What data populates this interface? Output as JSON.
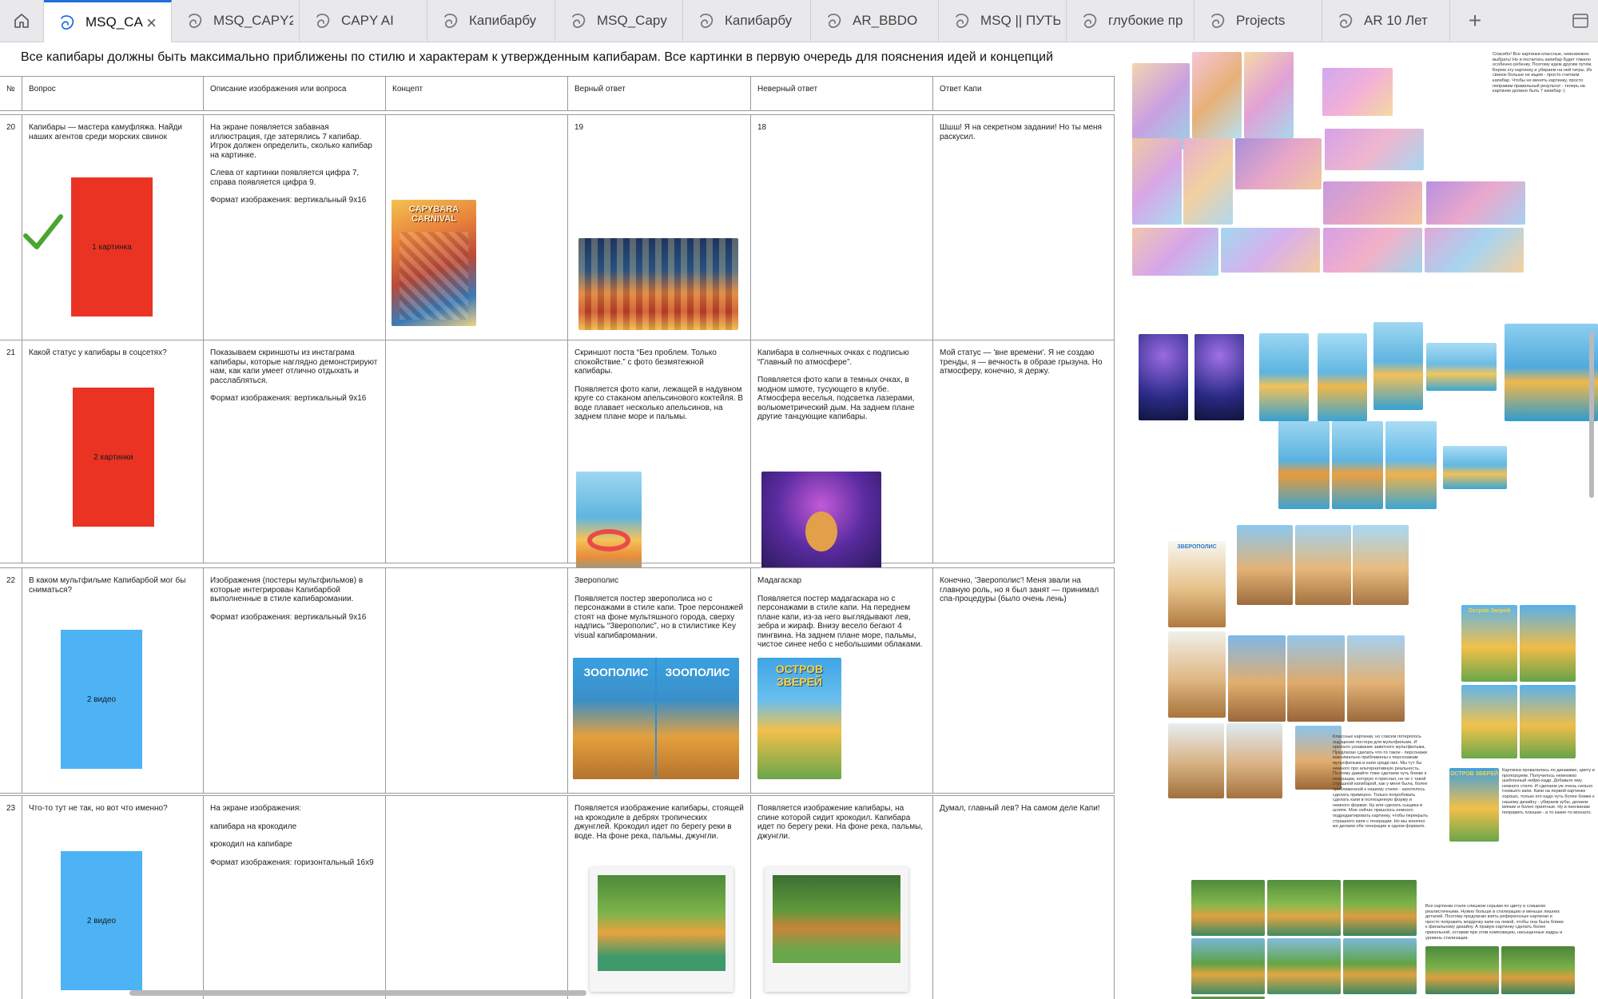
{
  "tabs": [
    {
      "label": "MSQ_CA",
      "active": true
    },
    {
      "label": "MSQ_CAPY2"
    },
    {
      "label": "CAPY AI"
    },
    {
      "label": "Капибарбу"
    },
    {
      "label": "MSQ_Capy"
    },
    {
      "label": "Капибарбу"
    },
    {
      "label": "AR_BBDO"
    },
    {
      "label": "MSQ || ПУТЬ"
    },
    {
      "label": "глубокие пр"
    },
    {
      "label": "Projects"
    },
    {
      "label": "AR 10 Лет"
    }
  ],
  "banner": "Все капибары должны быть максимально приближены по стилю и характерам к утвержденным капибарам. Все картинки в первую очередь для пояснения идей и концепций",
  "headers": {
    "num": "№",
    "question": "Вопрос",
    "description": "Описание изображения или вопроса",
    "concept": "Концепт",
    "correct": "Верный ответ",
    "wrong": "Неверный ответ",
    "kapi": "Ответ Капи"
  },
  "rows": [
    {
      "num": "20",
      "question": "Капибары — мастера камуфляжа. Найди наших агентов среди морских свинок",
      "media_label": "1 картинка",
      "description": [
        "На экране появляется забавная иллюстрация, где затерялись 7 капибар. Игрок должен определить, сколько капибар на картинке.",
        "Слева от картинки появляется цифра 7, справа появляется цифра 9.",
        "Формат изображения: вертикальный 9x16"
      ],
      "concept_image_text": "CAPYBARA CARNIVAL",
      "correct": [
        "19"
      ],
      "wrong": [
        "18"
      ],
      "kapi": "Шшш! Я на секретном задании! Но ты меня раскусил."
    },
    {
      "num": "21",
      "question": "Какой статус у капибары в соцсетях?",
      "media_label": "2 картинки",
      "description": [
        "Показываем скриншоты из инстаграма капибары, которые наглядно демонстрируют нам, как капи умеет отлично отдыхать и расслабляться.",
        "Формат изображения: вертикальный 9x16"
      ],
      "correct": [
        "Скриншот поста “Без проблем. Только спокойствие.” с фото безмятежной капибары.",
        "Появляется фото капи, лежащей в надувном круге со стаканом апельсинового коктейля. В воде плавает несколько апельсинов, на заднем плане море и пальмы."
      ],
      "wrong": [
        "Капибара в солнечных очках с подписью “Главный по атмосфере”.",
        "Появляется фото капи в темных очках, в модном шмоте, тусующего в клубе. Атмосфера веселья, подсветка лазерами, вольюметрический дым. На заднем плане другие танцующие капибары."
      ],
      "kapi": "Мой статус — 'вне времени'. Я не создаю тренды, я — вечность в образе грызуна. Но атмосферу, конечно, я держу."
    },
    {
      "num": "22",
      "question": "В каком мультфильме Капибарбой мог бы сниматься?",
      "media_label": "2 видео",
      "description": [
        "Изображения (постеры мультфильмов) в которые интегрирован Капибарбой выполненные в стиле капибаромании.",
        "Формат изображения: вертикальный 9x16"
      ],
      "correct": [
        "Зверополис",
        "Появляется постер зверополиса но с персонажами в стиле капи. Трое персонажей стоят на фоне мультяшного города, сверху надпись “Зверополис”, но в стилистике Key visual капибаромании."
      ],
      "correct_poster": "ЗООПОЛИС",
      "wrong": [
        "Мадагаскар",
        "Появляется постер мадагаскара но с персонажами в стиле капи. На переднем плане капи, из-за него выглядывают лев, зебра и жираф. Внизу весело бегают 4 пингвина. На заднем плане море, пальмы, чистое синее небо с небольшими облаками."
      ],
      "wrong_poster": "ОСТРОВ ЗВЕРЕЙ",
      "kapi": "Конечно, 'Зверополис'! Меня звали на главную роль, но я был занят — принимал спа-процедуры (было очень лень)"
    },
    {
      "num": "23",
      "question": "Что-то тут не так, но вот что именно?",
      "media_label": "2 видео",
      "description": [
        "На экране изображения:",
        "капибара на крокодиле",
        "крокодил на капибаре",
        "Формат изображения: горизонтальный 16x9"
      ],
      "correct": [
        "Появляется изображение капибары, стоящей на крокодиле в дебрях тропических джунглей. Крокодил идет по берегу реки в воде. На фоне река, пальмы, джунгли."
      ],
      "wrong": [
        "Появляется изображение капибары, на спине которой сидит крокодил. Капибара идет по берегу реки. На фоне река, пальмы, джунгли."
      ],
      "kapi": "Думал, главный лев? На самом деле Капи!"
    }
  ],
  "collage": {
    "poster_text_1": "ЗВЕРОПОЛИС",
    "poster_text_2": "Остров Зверей",
    "poster_text_3": "ОСТРОВ ЗВЕРЕЙ",
    "note_1": "Спасибо! Все картинки классные, невозможно выбрать! Но и посчитать капибар будет тяжело особенно ребенку. Поэтому идем другим путём.\nБерем эту картинку и убираем на ней тигры. Их свинок больше не ищем - просто считаем капибар. Чтобы не менять картинку, просто поправим правильный результат - теперь на картинке должно быть 7 капибар :)",
    "note_2": "Классные картинки, но совсем потерялось ощущение постера для мультфильма. И пропало узнавание заветного мультфильма. Предлагаю сделать что-то такое - персонажи максимально приближены к персонажам мультфильма и капи среди них. Мы тут бы немного про альтернативную реальность. Поэтому давайте тоже сделаем чуть ближе к генерации, которую я прислал, но не с такой страшной капибарой, как у меня была, более приближенной к нашему стилю - захотелось сделать примерно. Только попробовать сделать капи в полноценную форму и немного формат. Ну или сделать сыщика в шляпе.\nМне сейчас пришлось немного подредактировать картинку, чтобы перекрыть страшного капи с генерации. Но мы конечно же делаем обе генерации в одном формате.",
    "note_3": "Картинка провалилась по динамике, цвету и пропорциям. Получилось немножко шаблонный нейро-кадр. Добавьте ему немного стиля. И сделаем уж очень сильно гномьего капи. Капи на первой картинке хорошо, только его надо чуть более ближе к нашему дизайну - убираем зубы, делаем мягкие и более приятные.\nНу и пингвинам поправить плюшки - а то какие-то мохнато.",
    "note_4": "Все картинки стали слишком серыми по цвету и слишком реалистичными. Нужно больше в стилизацию и меньше лишних деталей. Поэтому предлагаю взять референсные картинки и просто поправить мордочку капи на левой, чтобы она была ближе к финальному дизайну. А правую картинку сделать более прикольной, оставив при этом композицию, насыщенные кадры и уровень стилизации."
  }
}
